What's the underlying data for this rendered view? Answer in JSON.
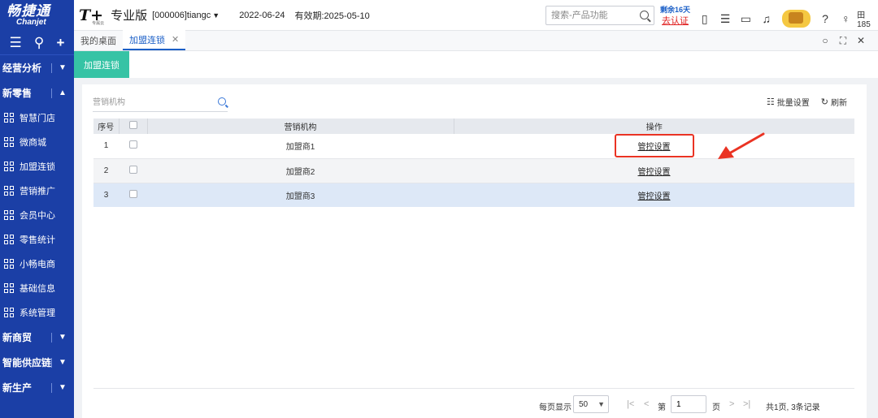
{
  "brand": {
    "cn": "畅捷通",
    "en": "Chanjet"
  },
  "sidebar": {
    "groups": [
      {
        "label": "经营分析",
        "chevron": "chevron-down-icon"
      },
      {
        "label": "新零售",
        "chevron": "chevron-up-icon"
      },
      {
        "label": "新商贸",
        "chevron": "chevron-down-icon"
      },
      {
        "label": "智能供应链",
        "chevron": "chevron-down-icon"
      },
      {
        "label": "新生产",
        "chevron": "chevron-down-icon"
      }
    ],
    "items": [
      {
        "label": "智慧门店"
      },
      {
        "label": "微商城"
      },
      {
        "label": "加盟连锁"
      },
      {
        "label": "营销推广"
      },
      {
        "label": "会员中心"
      },
      {
        "label": "零售统计"
      },
      {
        "label": "小畅电商"
      },
      {
        "label": "基础信息"
      },
      {
        "label": "系统管理"
      }
    ]
  },
  "header": {
    "product_logo": "T+",
    "product_logo_sub": "专属云",
    "edition": "专业版",
    "account": "[000006]tiangc",
    "date": "2022-06-24",
    "valid_until": "有效期:2025-05-10",
    "search_placeholder": "搜索-产品功能",
    "trial_days": "剩余16天",
    "certify": "去认证",
    "user_id": "田185"
  },
  "tabs": [
    {
      "label": "我的桌面"
    },
    {
      "label": "加盟连锁"
    }
  ],
  "subtab": "加盟连锁",
  "filter": {
    "placeholder": "营销机构"
  },
  "actions": {
    "batch": "批量设置",
    "refresh": "刷新"
  },
  "table": {
    "columns": [
      "序号",
      "",
      "营销机构",
      "操作"
    ],
    "rows": [
      {
        "index": "1",
        "org": "加盟商1",
        "action": "管控设置"
      },
      {
        "index": "2",
        "org": "加盟商2",
        "action": "管控设置"
      },
      {
        "index": "3",
        "org": "加盟商3",
        "action": "管控设置"
      }
    ]
  },
  "pager": {
    "per_page_label": "每页显示",
    "per_page": "50",
    "page_prefix": "第",
    "page": "1",
    "page_suffix": "页",
    "summary": "共1页, 3条记录"
  },
  "colors": {
    "sidebar_bg": "#1b3fa6",
    "subtab_bg": "#36c3a5",
    "highlight": "#ea3323",
    "selected_row": "#dde8f7"
  }
}
